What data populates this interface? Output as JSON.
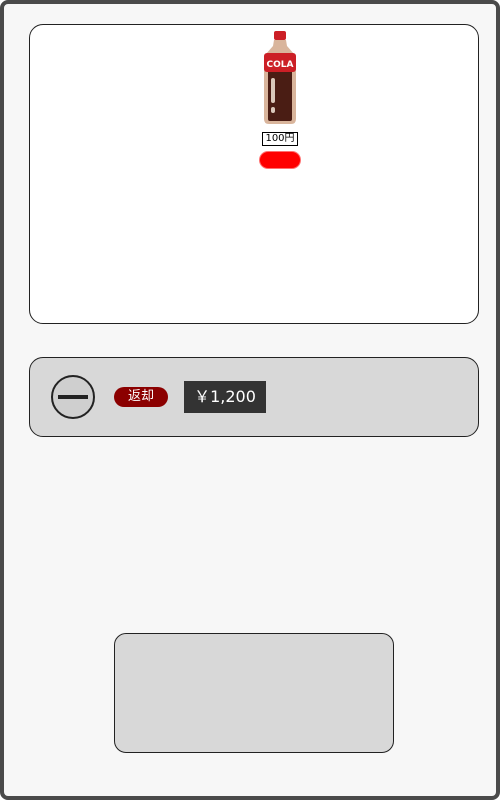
{
  "products": [
    {
      "label": "COLA",
      "price": "100円",
      "icon": "cola-bottle-icon",
      "button_color": "#ff0000"
    }
  ],
  "controls": {
    "coin_slot_icon": "coin-slot-icon",
    "return_label": "返却",
    "amount": "￥1,200"
  },
  "colors": {
    "frame": "#4a4a4a",
    "panel": "#d8d8d8",
    "buy_button": "#ff0000",
    "return_button": "#8b0000",
    "amount_display": "#333333"
  }
}
